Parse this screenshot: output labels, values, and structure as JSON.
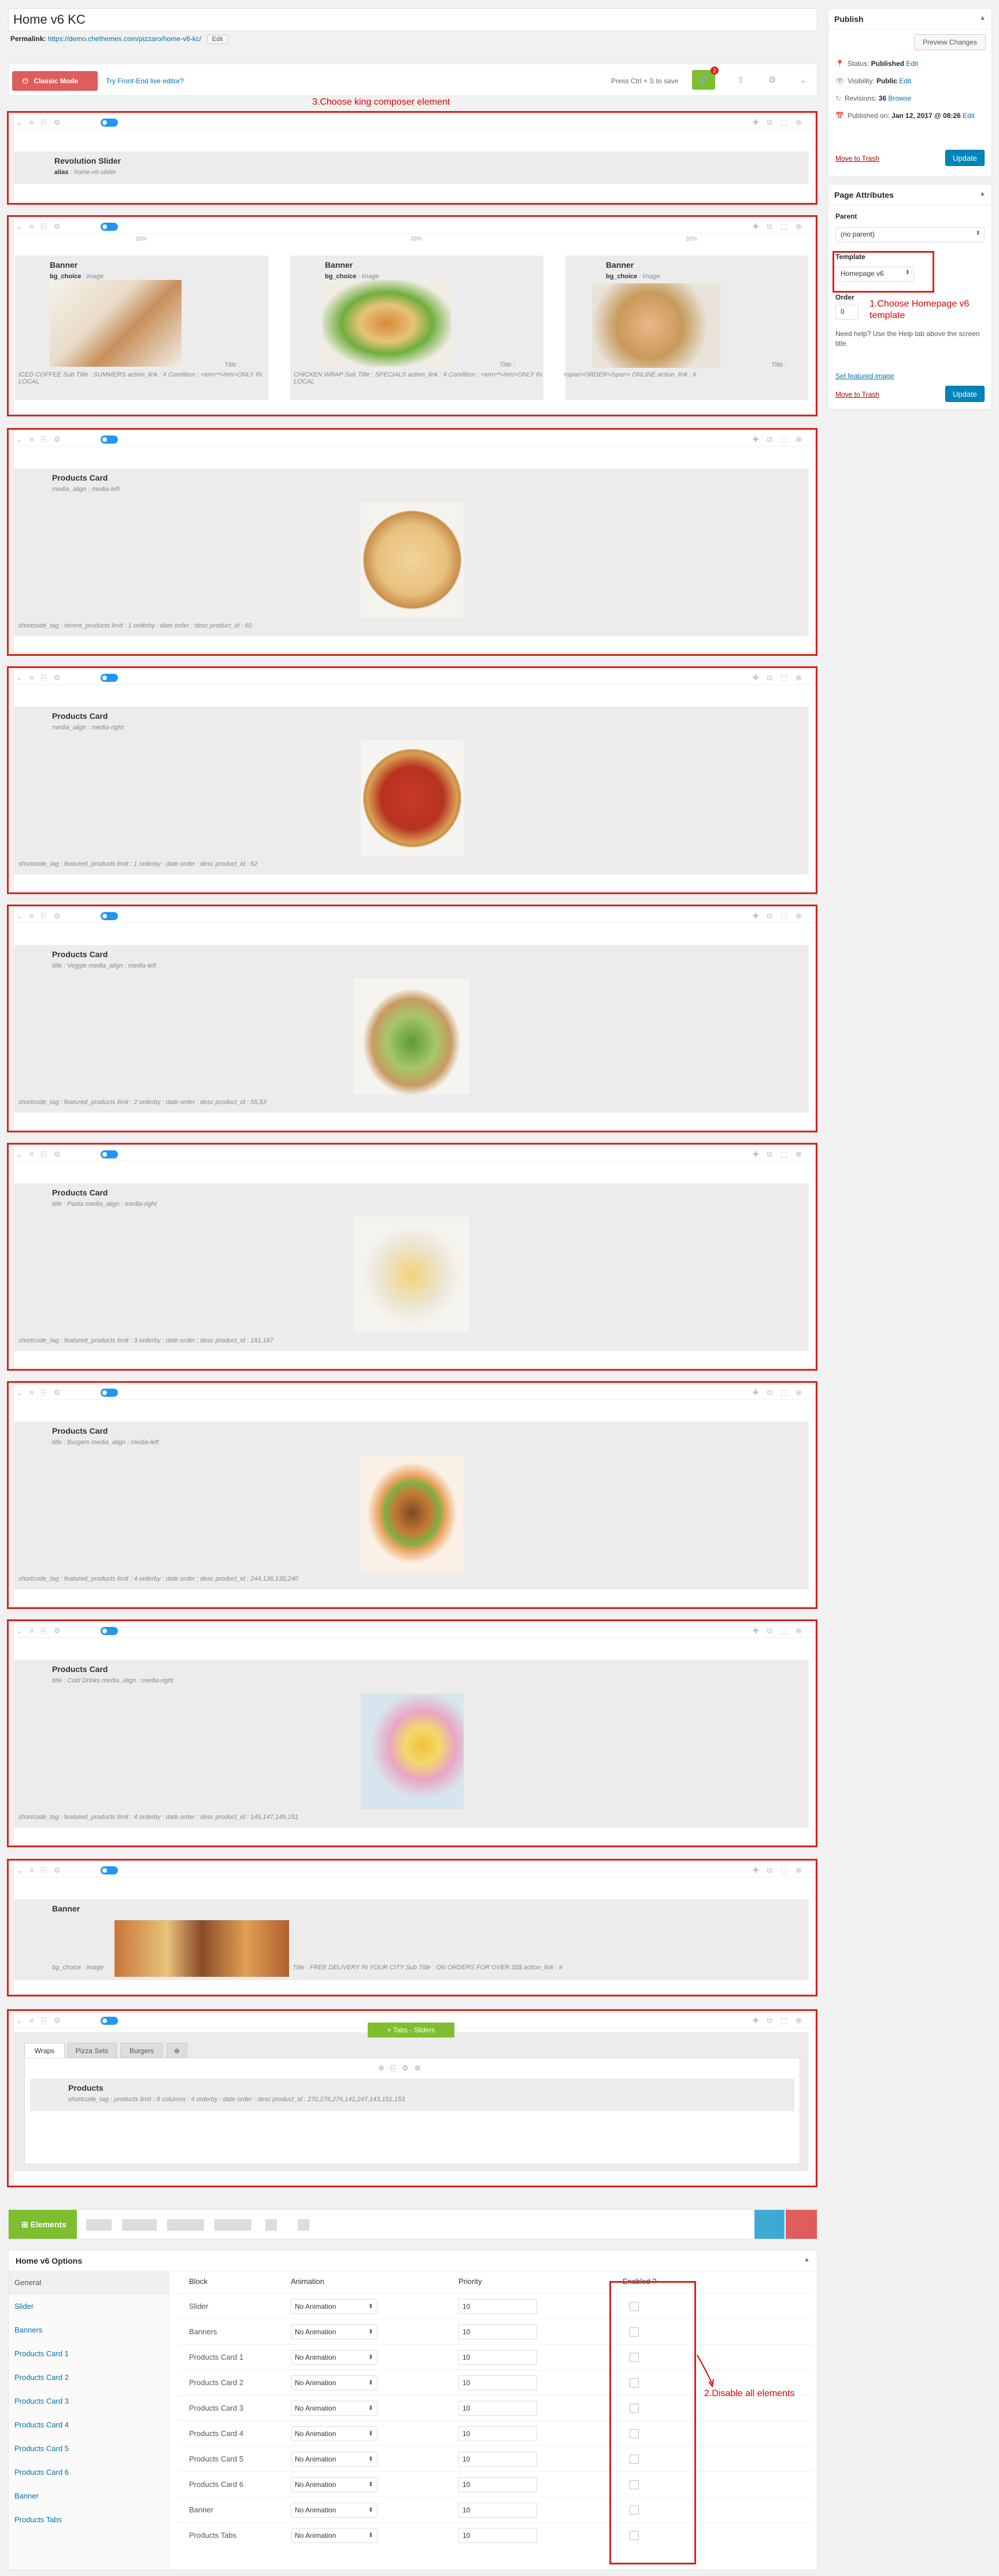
{
  "post": {
    "title": "Home v6 KC",
    "permalink_label": "Permalink:",
    "permalink_url": "https://demo.chethemes.com/pizzaro/home-v6-kc/",
    "edit_label": "Edit"
  },
  "toolbar": {
    "classic_mode": "Classic Mode",
    "frontend_link": "Try Front-End live editor?",
    "save_hint": "Press Ctrl + S to save",
    "badge_count": "2"
  },
  "annotations": {
    "choose_element": "3.Choose king composer element",
    "choose_template": "1.Choose Homepage v6 template",
    "disable_all": "2.Disable all elements"
  },
  "rows": {
    "slider": {
      "title": "Revolution Slider",
      "attr_key": "alias",
      "attr_val": "home-v6-slider"
    },
    "banners": [
      {
        "pct": "33%",
        "title": "Banner",
        "attr_key": "bg_choice",
        "attr_val": "image",
        "title_tag": "Title :",
        "caption": "ICED COFFEE Sub Title : SUMMERS action_link : # Condition : <em>*</em>ONLY IN LOCAL"
      },
      {
        "pct": "33%",
        "title": "Banner",
        "attr_key": "bg_choice",
        "attr_val": "image",
        "title_tag": "Title :",
        "caption": "CHICKEN WRAP Sub Title : SPECIALS action_link : # Condition : <em>*</em>ONLY IN LOCAL"
      },
      {
        "pct": "33%",
        "title": "Banner",
        "attr_key": "bg_choice",
        "attr_val": "image",
        "title_tag": "Title :",
        "caption": "<span>ORDER</span> ONLINE action_link : #"
      }
    ],
    "products": [
      {
        "title": "Products Card",
        "attrs": "media_align : media-left",
        "shortcode": "shortcode_tag : recent_products limit : 1 orderby : date order : desc product_id : 60"
      },
      {
        "title": "Products Card",
        "attrs": "media_align : media-right",
        "shortcode": "shortcode_tag : featured_products limit : 1 orderby : date order : desc product_id : 62"
      },
      {
        "title": "Products Card",
        "attrs": "title : Veggie media_align : media-left",
        "shortcode": "shortcode_tag : featured_products limit : 2 orderby : date order : desc product_id : 55,53"
      },
      {
        "title": "Products Card",
        "attrs": "title : Pasta media_align : media-right",
        "shortcode": "shortcode_tag : featured_products limit : 3 orderby : date order : desc product_id : 181,187"
      },
      {
        "title": "Products Card",
        "attrs": "title : Burgers media_align : media-left",
        "shortcode": "shortcode_tag : featured_products limit : 4 orderby : date order : desc product_id : 244,136,135,240"
      },
      {
        "title": "Products Card",
        "attrs": "title : Cold Drinks media_align : media-right",
        "shortcode": "shortcode_tag : featured_products limit : 4 orderby : date order : desc product_id : 145,147,149,151"
      }
    ],
    "wide_banner": {
      "title": "Banner",
      "attrs": "bg_choice : image",
      "caption": "Title : FREE DELIVERY IN YOUR CITY Sub Title : ON ORDERS FOR OVER 55$ action_link : #"
    },
    "tabs": {
      "button": "Tabs - Sliders",
      "tab_labels": [
        "Wraps",
        "Pizza Sets",
        "Burgers"
      ],
      "inner_title": "Products",
      "inner_shortcode": "shortcode_tag : products limit : 6 columns : 4 orderby : date order : desc product_id : 270,278,276,141,247,143,151,153"
    }
  },
  "elements_bar": {
    "label": "Elements"
  },
  "publish": {
    "heading": "Publish",
    "preview": "Preview Changes",
    "status_label": "Status:",
    "status_value": "Published",
    "visibility_label": "Visibility:",
    "visibility_value": "Public",
    "revisions_label": "Revisions:",
    "revisions_value": "36",
    "browse": "Browse",
    "published_label": "Published on:",
    "published_value": "Jan 12, 2017 @ 08:26",
    "edit": "Edit",
    "trash": "Move to Trash",
    "update": "Update"
  },
  "page_attributes": {
    "heading": "Page Attributes",
    "parent_label": "Parent",
    "parent_value": "(no parent)",
    "template_label": "Template",
    "template_value": "Homepage v6",
    "order_label": "Order",
    "order_value": "0",
    "help": "Need help? Use the Help tab above the screen title.",
    "featured": "Set featured image",
    "trash": "Move to Trash",
    "update": "Update"
  },
  "options": {
    "heading": "Home v6 Options",
    "nav": [
      "General",
      "Slider",
      "Banners",
      "Products Card 1",
      "Products Card 2",
      "Products Card 3",
      "Products Card 4",
      "Products Card 5",
      "Products Card 6",
      "Banner",
      "Products Tabs"
    ],
    "headers": {
      "block": "Block",
      "animation": "Animation",
      "priority": "Priority",
      "enabled": "Enabled ?"
    },
    "rows": [
      {
        "block": "Slider",
        "animation": "No Animation",
        "priority": "10"
      },
      {
        "block": "Banners",
        "animation": "No Animation",
        "priority": "10"
      },
      {
        "block": "Products Card 1",
        "animation": "No Animation",
        "priority": "10"
      },
      {
        "block": "Products Card 2",
        "animation": "No Animation",
        "priority": "10"
      },
      {
        "block": "Products Card 3",
        "animation": "No Animation",
        "priority": "10"
      },
      {
        "block": "Products Card 4",
        "animation": "No Animation",
        "priority": "10"
      },
      {
        "block": "Products Card 5",
        "animation": "No Animation",
        "priority": "10"
      },
      {
        "block": "Products Card 6",
        "animation": "No Animation",
        "priority": "10"
      },
      {
        "block": "Banner",
        "animation": "No Animation",
        "priority": "10"
      },
      {
        "block": "Products Tabs",
        "animation": "No Animation",
        "priority": "10"
      }
    ]
  }
}
